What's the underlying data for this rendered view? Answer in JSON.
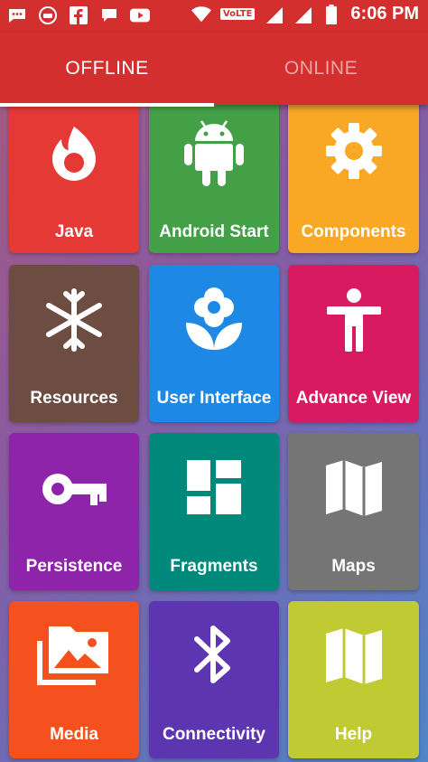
{
  "status_bar": {
    "time": "6:06 PM",
    "volte": "VoLTE",
    "icons": [
      "message-icon",
      "sq-lite-icon",
      "facebook-icon",
      "chat-icon",
      "youtube-icon",
      "wifi-icon",
      "signal-icon",
      "signal-icon",
      "battery-icon"
    ]
  },
  "tabs": [
    {
      "label": "OFFLINE",
      "selected": true
    },
    {
      "label": "ONLINE",
      "selected": false
    }
  ],
  "colors": {
    "app_bar": "#d32f2f",
    "java": "#e53935",
    "android_start": "#43a047",
    "components": "#f9a825",
    "resources": "#6d4c41",
    "user_interface": "#1e88e5",
    "advance_view": "#d81b60",
    "persistence": "#8e24aa",
    "fragments": "#00897b",
    "maps": "#757575",
    "media": "#f4511e",
    "connectivity": "#5e35b1",
    "help": "#c0ca33"
  },
  "tiles": [
    {
      "label": "Java",
      "icon": "fire-icon"
    },
    {
      "label": "Android Start",
      "icon": "android-icon"
    },
    {
      "label": "Components",
      "icon": "gear-icon"
    },
    {
      "label": "Resources",
      "icon": "snowflake-icon"
    },
    {
      "label": "User Interface",
      "icon": "flower-icon"
    },
    {
      "label": "Advance View",
      "icon": "accessibility-icon"
    },
    {
      "label": "Persistence",
      "icon": "key-icon"
    },
    {
      "label": "Fragments",
      "icon": "dashboard-icon"
    },
    {
      "label": "Maps",
      "icon": "map-icon"
    },
    {
      "label": "Media",
      "icon": "photo-library-icon"
    },
    {
      "label": "Connectivity",
      "icon": "bluetooth-icon"
    },
    {
      "label": "Help",
      "icon": "map-icon"
    }
  ]
}
